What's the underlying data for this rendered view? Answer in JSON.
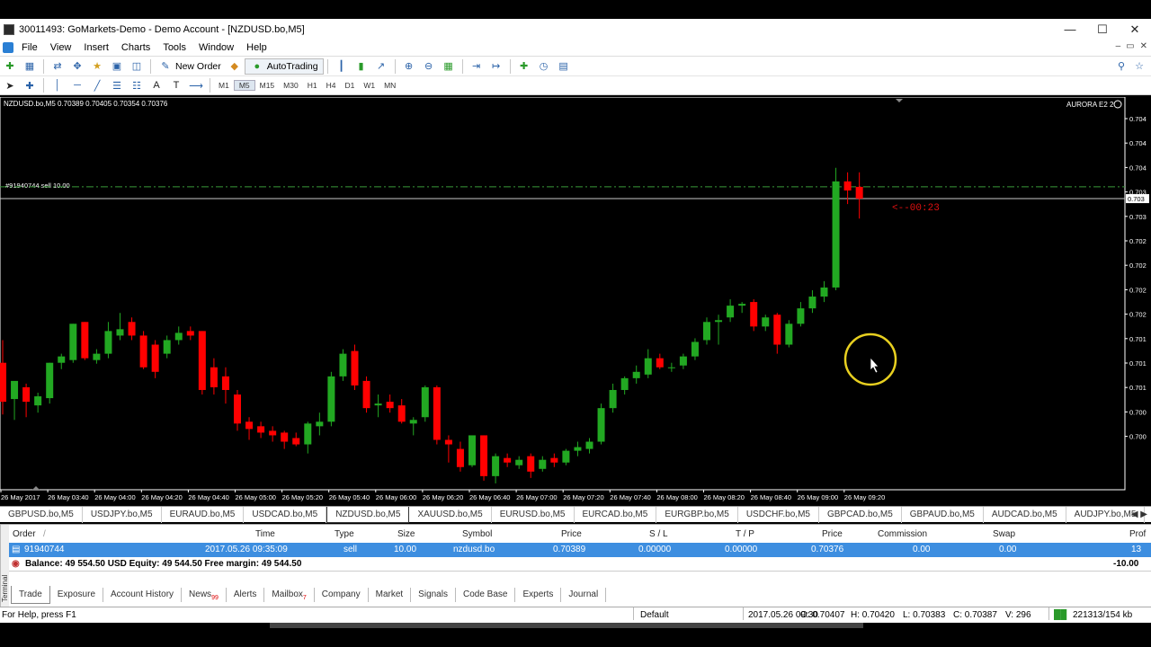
{
  "window": {
    "title": "30011493: GoMarkets-Demo - Demo Account - [NZDUSD.bo,M5]",
    "controls": {
      "minimize": "—",
      "maximize": "☐",
      "close": "✕"
    }
  },
  "menu": [
    "File",
    "View",
    "Insert",
    "Charts",
    "Tools",
    "Window",
    "Help"
  ],
  "toolbar": {
    "new_order": "New Order",
    "auto_trading": "AutoTrading"
  },
  "timeframes": [
    "M1",
    "M5",
    "M15",
    "M30",
    "H1",
    "H4",
    "D1",
    "W1",
    "MN"
  ],
  "active_timeframe": "M5",
  "chart": {
    "header": "NZDUSD.bo,M5  0.70389 0.70405 0.70354 0.70376",
    "indicator_label": "AURORA E2 2",
    "order_label": "#91940744 sell 10.00",
    "countdown": "<--00:23",
    "price_axis": [
      "0.704",
      "0.704",
      "0.704",
      "0.703",
      "0.703",
      "0.702",
      "0.702",
      "0.702",
      "0.702",
      "0.701",
      "0.701",
      "0.701",
      "0.700",
      "0.700"
    ],
    "current_price_tag": "0.703",
    "time_axis": [
      "26 May 2017",
      "26 May 03:40",
      "26 May 04:00",
      "26 May 04:20",
      "26 May 04:40",
      "26 May 05:00",
      "26 May 05:20",
      "26 May 05:40",
      "26 May 06:00",
      "26 May 06:20",
      "26 May 06:40",
      "26 May 07:00",
      "26 May 07:20",
      "26 May 07:40",
      "26 May 08:00",
      "26 May 08:20",
      "26 May 08:40",
      "26 May 09:00",
      "26 May 09:20"
    ],
    "colors": {
      "bull": "#22a822",
      "bear": "#ff0000",
      "background": "#000000",
      "order_line": "#3a9a3a"
    }
  },
  "chart_data": {
    "type": "candlestick",
    "symbol": "NZDUSD.bo",
    "timeframe": "M5",
    "ylim": [
      0.70055,
      0.70488
    ],
    "order_price": 0.70389,
    "current_price": 0.70376,
    "candles": [
      {
        "o": 0.70195,
        "h": 0.7022,
        "l": 0.70138,
        "c": 0.70152
      },
      {
        "o": 0.70155,
        "h": 0.70172,
        "l": 0.70132,
        "c": 0.70175
      },
      {
        "o": 0.70168,
        "h": 0.70172,
        "l": 0.70135,
        "c": 0.70152
      },
      {
        "o": 0.70148,
        "h": 0.70162,
        "l": 0.7014,
        "c": 0.70158
      },
      {
        "o": 0.70156,
        "h": 0.70195,
        "l": 0.7015,
        "c": 0.70195
      },
      {
        "o": 0.70195,
        "h": 0.70205,
        "l": 0.70188,
        "c": 0.70202
      },
      {
        "o": 0.70198,
        "h": 0.70238,
        "l": 0.70195,
        "c": 0.70238
      },
      {
        "o": 0.7024,
        "h": 0.7024,
        "l": 0.70198,
        "c": 0.702
      },
      {
        "o": 0.70198,
        "h": 0.7021,
        "l": 0.70194,
        "c": 0.70205
      },
      {
        "o": 0.70205,
        "h": 0.7024,
        "l": 0.702,
        "c": 0.7023
      },
      {
        "o": 0.70225,
        "h": 0.7025,
        "l": 0.7022,
        "c": 0.70232
      },
      {
        "o": 0.7024,
        "h": 0.70245,
        "l": 0.7022,
        "c": 0.70225
      },
      {
        "o": 0.70225,
        "h": 0.7023,
        "l": 0.70188,
        "c": 0.7019
      },
      {
        "o": 0.70215,
        "h": 0.7022,
        "l": 0.70178,
        "c": 0.70185
      },
      {
        "o": 0.70205,
        "h": 0.70225,
        "l": 0.702,
        "c": 0.7022
      },
      {
        "o": 0.7022,
        "h": 0.70235,
        "l": 0.70215,
        "c": 0.70228
      },
      {
        "o": 0.7023,
        "h": 0.70235,
        "l": 0.7022,
        "c": 0.70225
      },
      {
        "o": 0.7023,
        "h": 0.7023,
        "l": 0.7016,
        "c": 0.70165
      },
      {
        "o": 0.7019,
        "h": 0.702,
        "l": 0.7016,
        "c": 0.70168
      },
      {
        "o": 0.7018,
        "h": 0.7019,
        "l": 0.7015,
        "c": 0.70165
      },
      {
        "o": 0.7016,
        "h": 0.70165,
        "l": 0.7012,
        "c": 0.70128
      },
      {
        "o": 0.7013,
        "h": 0.70135,
        "l": 0.7011,
        "c": 0.70122
      },
      {
        "o": 0.70125,
        "h": 0.7013,
        "l": 0.70112,
        "c": 0.70118
      },
      {
        "o": 0.7012,
        "h": 0.70125,
        "l": 0.70108,
        "c": 0.70115
      },
      {
        "o": 0.70118,
        "h": 0.7012,
        "l": 0.701,
        "c": 0.70108
      },
      {
        "o": 0.70112,
        "h": 0.70118,
        "l": 0.70103,
        "c": 0.70105
      },
      {
        "o": 0.70105,
        "h": 0.7013,
        "l": 0.70095,
        "c": 0.70128
      },
      {
        "o": 0.70125,
        "h": 0.7014,
        "l": 0.70115,
        "c": 0.7013
      },
      {
        "o": 0.7013,
        "h": 0.70185,
        "l": 0.70125,
        "c": 0.7018
      },
      {
        "o": 0.7018,
        "h": 0.7021,
        "l": 0.70175,
        "c": 0.70205
      },
      {
        "o": 0.70208,
        "h": 0.70215,
        "l": 0.70165,
        "c": 0.7017
      },
      {
        "o": 0.70175,
        "h": 0.7018,
        "l": 0.7014,
        "c": 0.70145
      },
      {
        "o": 0.70148,
        "h": 0.7016,
        "l": 0.70135,
        "c": 0.7015
      },
      {
        "o": 0.70152,
        "h": 0.7016,
        "l": 0.7014,
        "c": 0.70145
      },
      {
        "o": 0.70148,
        "h": 0.70155,
        "l": 0.70128,
        "c": 0.7013
      },
      {
        "o": 0.70128,
        "h": 0.70135,
        "l": 0.70115,
        "c": 0.70132
      },
      {
        "o": 0.70135,
        "h": 0.7017,
        "l": 0.7013,
        "c": 0.70168
      },
      {
        "o": 0.70168,
        "h": 0.7017,
        "l": 0.70105,
        "c": 0.7011
      },
      {
        "o": 0.7011,
        "h": 0.70115,
        "l": 0.70085,
        "c": 0.70105
      },
      {
        "o": 0.701,
        "h": 0.70108,
        "l": 0.70075,
        "c": 0.7008
      },
      {
        "o": 0.70082,
        "h": 0.70115,
        "l": 0.7008,
        "c": 0.70115
      },
      {
        "o": 0.70115,
        "h": 0.70115,
        "l": 0.70065,
        "c": 0.7007
      },
      {
        "o": 0.7007,
        "h": 0.70095,
        "l": 0.70062,
        "c": 0.70092
      },
      {
        "o": 0.7009,
        "h": 0.70095,
        "l": 0.7008,
        "c": 0.70085
      },
      {
        "o": 0.70082,
        "h": 0.70092,
        "l": 0.70078,
        "c": 0.70088
      },
      {
        "o": 0.70092,
        "h": 0.70095,
        "l": 0.70068,
        "c": 0.70075
      },
      {
        "o": 0.70078,
        "h": 0.70092,
        "l": 0.70075,
        "c": 0.70088
      },
      {
        "o": 0.7009,
        "h": 0.70095,
        "l": 0.7008,
        "c": 0.70085
      },
      {
        "o": 0.70085,
        "h": 0.701,
        "l": 0.70082,
        "c": 0.70098
      },
      {
        "o": 0.70098,
        "h": 0.70108,
        "l": 0.70092,
        "c": 0.70102
      },
      {
        "o": 0.701,
        "h": 0.70112,
        "l": 0.70095,
        "c": 0.70108
      },
      {
        "o": 0.70108,
        "h": 0.7015,
        "l": 0.70105,
        "c": 0.70145
      },
      {
        "o": 0.70145,
        "h": 0.70172,
        "l": 0.7014,
        "c": 0.70165
      },
      {
        "o": 0.70165,
        "h": 0.7018,
        "l": 0.7016,
        "c": 0.70178
      },
      {
        "o": 0.70178,
        "h": 0.70192,
        "l": 0.70172,
        "c": 0.70185
      },
      {
        "o": 0.70182,
        "h": 0.7021,
        "l": 0.70178,
        "c": 0.702
      },
      {
        "o": 0.702,
        "h": 0.70205,
        "l": 0.70188,
        "c": 0.7019
      },
      {
        "o": 0.7019,
        "h": 0.70195,
        "l": 0.70185,
        "c": 0.7019
      },
      {
        "o": 0.70192,
        "h": 0.70205,
        "l": 0.70188,
        "c": 0.70202
      },
      {
        "o": 0.70202,
        "h": 0.70222,
        "l": 0.70198,
        "c": 0.70218
      },
      {
        "o": 0.7022,
        "h": 0.70245,
        "l": 0.70215,
        "c": 0.7024
      },
      {
        "o": 0.7024,
        "h": 0.70248,
        "l": 0.70215,
        "c": 0.70242
      },
      {
        "o": 0.70245,
        "h": 0.70265,
        "l": 0.7024,
        "c": 0.70258
      },
      {
        "o": 0.70258,
        "h": 0.70262,
        "l": 0.7025,
        "c": 0.7026
      },
      {
        "o": 0.70262,
        "h": 0.70265,
        "l": 0.7023,
        "c": 0.70235
      },
      {
        "o": 0.70235,
        "h": 0.70248,
        "l": 0.7023,
        "c": 0.70245
      },
      {
        "o": 0.70248,
        "h": 0.7025,
        "l": 0.70205,
        "c": 0.70215
      },
      {
        "o": 0.70215,
        "h": 0.70242,
        "l": 0.70212,
        "c": 0.70238
      },
      {
        "o": 0.70238,
        "h": 0.70262,
        "l": 0.70235,
        "c": 0.70255
      },
      {
        "o": 0.70255,
        "h": 0.70275,
        "l": 0.7025,
        "c": 0.70268
      },
      {
        "o": 0.70268,
        "h": 0.70285,
        "l": 0.70262,
        "c": 0.70278
      },
      {
        "o": 0.70278,
        "h": 0.7041,
        "l": 0.70275,
        "c": 0.70395
      },
      {
        "o": 0.70395,
        "h": 0.70405,
        "l": 0.7037,
        "c": 0.70385
      },
      {
        "o": 0.70389,
        "h": 0.70405,
        "l": 0.70354,
        "c": 0.70376
      }
    ]
  },
  "symbol_tabs": [
    "GBPUSD.bo,M5",
    "USDJPY.bo,M5",
    "EURAUD.bo,M5",
    "USDCAD.bo,M5",
    "NZDUSD.bo,M5",
    "XAUUSD.bo,M5",
    "EURUSD.bo,M5",
    "EURCAD.bo,M5",
    "EURGBP.bo,M5",
    "USDCHF.bo,M5",
    "GBPCAD.bo,M5",
    "GBPAUD.bo,M5",
    "AUDCAD.bo,M5",
    "AUDJPY.bo,M5"
  ],
  "active_symbol_tab": "NZDUSD.bo,M5",
  "terminal": {
    "side_label": "Terminal",
    "columns": {
      "order": "Order",
      "time": "Time",
      "type": "Type",
      "size": "Size",
      "symbol": "Symbol",
      "price": "Price",
      "sl": "S / L",
      "tp": "T / P",
      "price2": "Price",
      "commission": "Commission",
      "swap": "Swap",
      "profit": "Prof"
    },
    "order_row": {
      "order": "91940744",
      "time": "2017.05.26 09:35:09",
      "type": "sell",
      "size": "10.00",
      "symbol": "nzdusd.bo",
      "price": "0.70389",
      "sl": "0.00000",
      "tp": "0.00000",
      "price2": "0.70376",
      "commission": "0.00",
      "swap": "0.00",
      "profit": "13"
    },
    "balance_row": {
      "text": "Balance: 49 554.50 USD  Equity: 49 544.50  Free margin: 49 544.50",
      "profit": "-10.00"
    },
    "tabs": [
      {
        "label": "Trade",
        "badge": ""
      },
      {
        "label": "Exposure",
        "badge": ""
      },
      {
        "label": "Account History",
        "badge": ""
      },
      {
        "label": "News",
        "badge": "99"
      },
      {
        "label": "Alerts",
        "badge": ""
      },
      {
        "label": "Mailbox",
        "badge": "7"
      },
      {
        "label": "Company",
        "badge": ""
      },
      {
        "label": "Market",
        "badge": ""
      },
      {
        "label": "Signals",
        "badge": ""
      },
      {
        "label": "Code Base",
        "badge": ""
      },
      {
        "label": "Experts",
        "badge": ""
      },
      {
        "label": "Journal",
        "badge": ""
      }
    ]
  },
  "status": {
    "help": "For Help, press F1",
    "profile": "Default",
    "datetime": "2017.05.26 09:30",
    "open": "O: 0.70407",
    "high": "H: 0.70420",
    "low": "L: 0.70383",
    "close": "C: 0.70387",
    "volume": "V: 296",
    "traffic": "221313/154 kb"
  }
}
